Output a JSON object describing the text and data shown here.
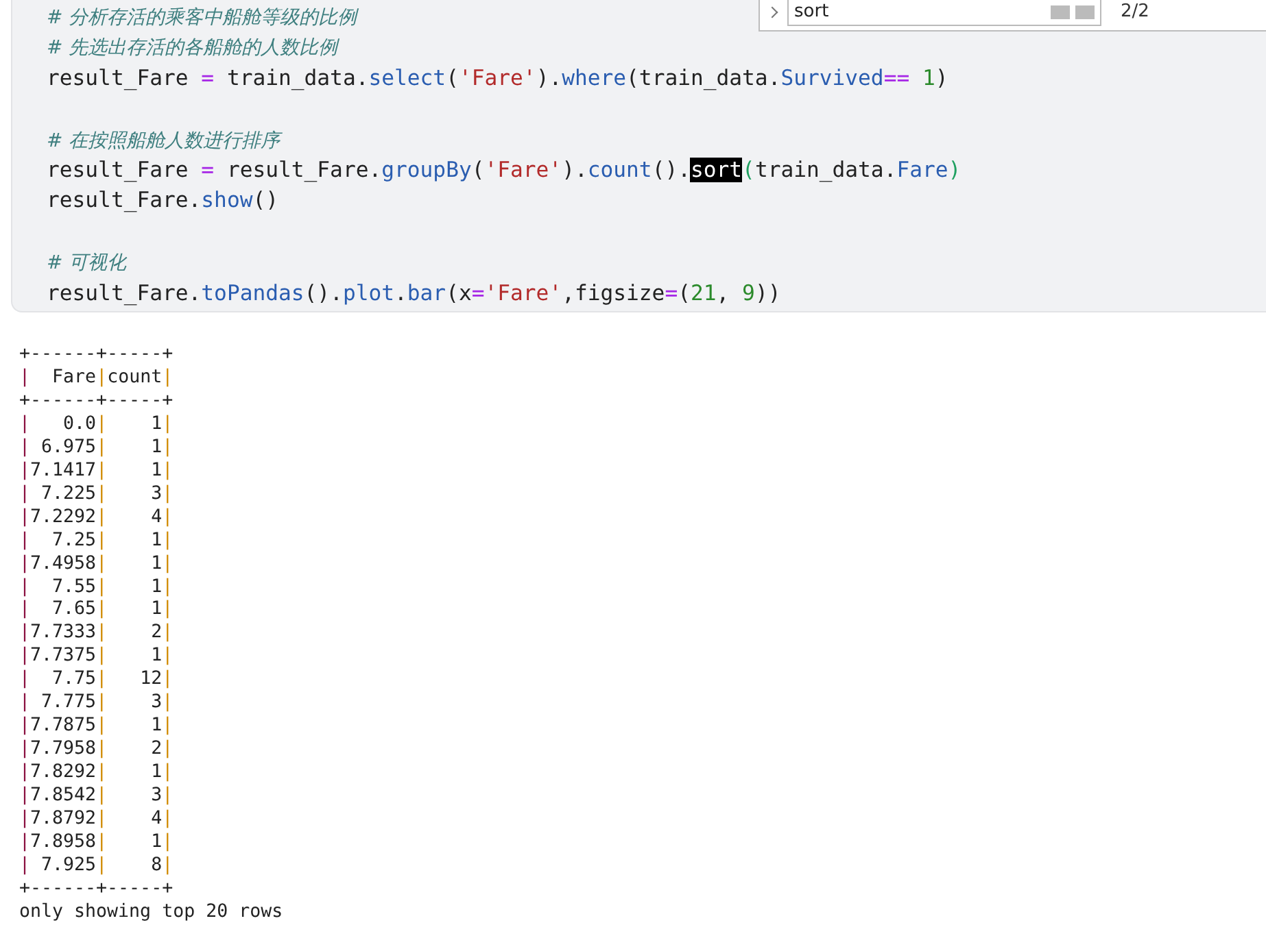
{
  "find_bar": {
    "value": "sort",
    "count": "2/2"
  },
  "code_cell": {
    "lines": [
      {
        "kind": "code",
        "tokens": [
          {
            "kind": "comment",
            "text": "# 分析存活的乘客中船舱等级的比例"
          }
        ]
      },
      {
        "kind": "code",
        "tokens": [
          {
            "kind": "comment",
            "text": "# 先选出存活的各船舱的人数比例"
          }
        ]
      },
      {
        "kind": "code",
        "tokens": [
          {
            "kind": "plain",
            "text": "result_Fare "
          },
          {
            "kind": "op",
            "text": "="
          },
          {
            "kind": "plain",
            "text": " train_data."
          },
          {
            "kind": "method",
            "text": "select"
          },
          {
            "kind": "plain",
            "text": "("
          },
          {
            "kind": "string",
            "text": "'Fare'"
          },
          {
            "kind": "plain",
            "text": ")."
          },
          {
            "kind": "method",
            "text": "where"
          },
          {
            "kind": "plain",
            "text": "(train_data."
          },
          {
            "kind": "method",
            "text": "Survived"
          },
          {
            "kind": "op",
            "text": "== "
          },
          {
            "kind": "number",
            "text": "1"
          },
          {
            "kind": "plain",
            "text": ")"
          }
        ]
      },
      {
        "kind": "blank"
      },
      {
        "kind": "code",
        "tokens": [
          {
            "kind": "comment",
            "text": "# 在按照船舱人数进行排序"
          }
        ]
      },
      {
        "kind": "code",
        "tokens": [
          {
            "kind": "plain",
            "text": "result_Fare "
          },
          {
            "kind": "op",
            "text": "="
          },
          {
            "kind": "plain",
            "text": " result_Fare."
          },
          {
            "kind": "method",
            "text": "groupBy"
          },
          {
            "kind": "plain",
            "text": "("
          },
          {
            "kind": "string",
            "text": "'Fare'"
          },
          {
            "kind": "plain",
            "text": ")."
          },
          {
            "kind": "method",
            "text": "count"
          },
          {
            "kind": "plain",
            "text": "()."
          },
          {
            "kind": "highlight",
            "text": "sort"
          },
          {
            "kind": "bracket",
            "text": "("
          },
          {
            "kind": "plain",
            "text": "train_data."
          },
          {
            "kind": "method",
            "text": "Fare"
          },
          {
            "kind": "bracket",
            "text": ")"
          }
        ]
      },
      {
        "kind": "code",
        "tokens": [
          {
            "kind": "plain",
            "text": "result_Fare."
          },
          {
            "kind": "method",
            "text": "show"
          },
          {
            "kind": "plain",
            "text": "()"
          }
        ]
      },
      {
        "kind": "blank"
      },
      {
        "kind": "code",
        "tokens": [
          {
            "kind": "comment",
            "text": "# 可视化"
          }
        ]
      },
      {
        "kind": "code",
        "tokens": [
          {
            "kind": "plain",
            "text": "result_Fare."
          },
          {
            "kind": "method",
            "text": "toPandas"
          },
          {
            "kind": "plain",
            "text": "()."
          },
          {
            "kind": "method",
            "text": "plot"
          },
          {
            "kind": "plain",
            "text": "."
          },
          {
            "kind": "method",
            "text": "bar"
          },
          {
            "kind": "plain",
            "text": "(x"
          },
          {
            "kind": "op",
            "text": "="
          },
          {
            "kind": "string",
            "text": "'Fare'"
          },
          {
            "kind": "plain",
            "text": ",figsize"
          },
          {
            "kind": "op",
            "text": "="
          },
          {
            "kind": "plain",
            "text": "("
          },
          {
            "kind": "number",
            "text": "21"
          },
          {
            "kind": "plain",
            "text": ", "
          },
          {
            "kind": "number",
            "text": "9"
          },
          {
            "kind": "plain",
            "text": "))"
          }
        ]
      }
    ]
  },
  "output": {
    "lines": [
      {
        "kind": "rule",
        "parts": [
          "+------+-----+"
        ]
      },
      {
        "kind": "row",
        "parts": [
          "|",
          "  Fare",
          "|",
          "count",
          "|"
        ]
      },
      {
        "kind": "rule",
        "parts": [
          "+------+-----+"
        ]
      },
      {
        "kind": "row",
        "parts": [
          "|",
          "   0.0",
          "|",
          "    1",
          "|"
        ]
      },
      {
        "kind": "row",
        "parts": [
          "|",
          " 6.975",
          "|",
          "    1",
          "|"
        ]
      },
      {
        "kind": "row",
        "parts": [
          "|",
          "7.1417",
          "|",
          "    1",
          "|"
        ]
      },
      {
        "kind": "row",
        "parts": [
          "|",
          " 7.225",
          "|",
          "    3",
          "|"
        ]
      },
      {
        "kind": "row",
        "parts": [
          "|",
          "7.2292",
          "|",
          "    4",
          "|"
        ]
      },
      {
        "kind": "row",
        "parts": [
          "|",
          "  7.25",
          "|",
          "    1",
          "|"
        ]
      },
      {
        "kind": "row",
        "parts": [
          "|",
          "7.4958",
          "|",
          "    1",
          "|"
        ]
      },
      {
        "kind": "row",
        "parts": [
          "|",
          "  7.55",
          "|",
          "    1",
          "|"
        ]
      },
      {
        "kind": "row",
        "parts": [
          "|",
          "  7.65",
          "|",
          "    1",
          "|"
        ]
      },
      {
        "kind": "row",
        "parts": [
          "|",
          "7.7333",
          "|",
          "    2",
          "|"
        ]
      },
      {
        "kind": "row",
        "parts": [
          "|",
          "7.7375",
          "|",
          "    1",
          "|"
        ]
      },
      {
        "kind": "row",
        "parts": [
          "|",
          "  7.75",
          "|",
          "   12",
          "|"
        ]
      },
      {
        "kind": "row",
        "parts": [
          "|",
          " 7.775",
          "|",
          "    3",
          "|"
        ]
      },
      {
        "kind": "row",
        "parts": [
          "|",
          "7.7875",
          "|",
          "    1",
          "|"
        ]
      },
      {
        "kind": "row",
        "parts": [
          "|",
          "7.7958",
          "|",
          "    2",
          "|"
        ]
      },
      {
        "kind": "row",
        "parts": [
          "|",
          "7.8292",
          "|",
          "    1",
          "|"
        ]
      },
      {
        "kind": "row",
        "parts": [
          "|",
          "7.8542",
          "|",
          "    3",
          "|"
        ]
      },
      {
        "kind": "row",
        "parts": [
          "|",
          "7.8792",
          "|",
          "    4",
          "|"
        ]
      },
      {
        "kind": "row",
        "parts": [
          "|",
          "7.8958",
          "|",
          "    1",
          "|"
        ]
      },
      {
        "kind": "row",
        "parts": [
          "|",
          " 7.925",
          "|",
          "    8",
          "|"
        ]
      },
      {
        "kind": "rule",
        "parts": [
          "+------+-----+"
        ]
      },
      {
        "kind": "text",
        "parts": [
          "only showing top 20 rows"
        ]
      }
    ]
  }
}
